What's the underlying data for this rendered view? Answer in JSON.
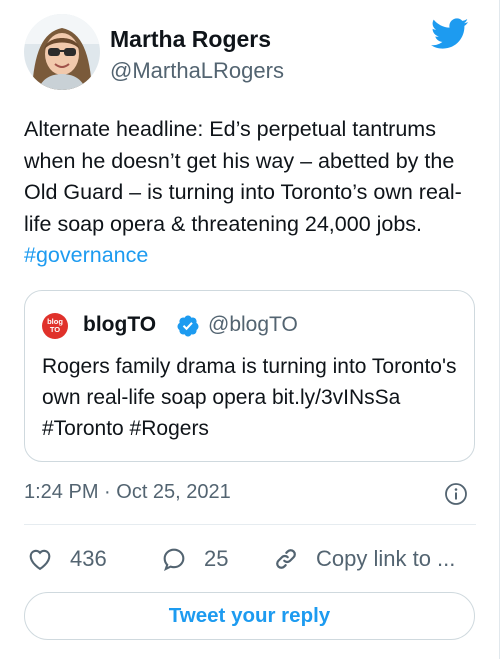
{
  "author": {
    "display_name": "Martha Rogers",
    "handle": "@MarthaLRogers",
    "avatar_icon": "person-avatar"
  },
  "tweet": {
    "text": "Alternate headline:  Ed’s perpetual tantrums when he doesn’t get his way – abetted by the Old Guard – is turning into Toronto’s own real-life soap opera & threatening 24,000 jobs. ",
    "hashtag": "#governance"
  },
  "quoted_tweet": {
    "logo_text_top": "blog",
    "logo_text_bottom": "TO",
    "display_name": "blogTO",
    "handle": "@blogTO",
    "text": "Rogers family drama is turning into Toronto's own real-life soap opera bit.ly/3vINsSa #Toronto #Rogers"
  },
  "timestamp": "1:24 PM · Oct 25, 2021",
  "actions": {
    "like_count": "436",
    "reply_count": "25",
    "copy_label": "Copy link to ..."
  },
  "reply_button_label": "Tweet your reply",
  "colors": {
    "accent": "#1d9bf0",
    "text": "#0f1419",
    "secondary": "#536471",
    "border": "#cfd9de",
    "blogto_red": "#e0312b"
  }
}
